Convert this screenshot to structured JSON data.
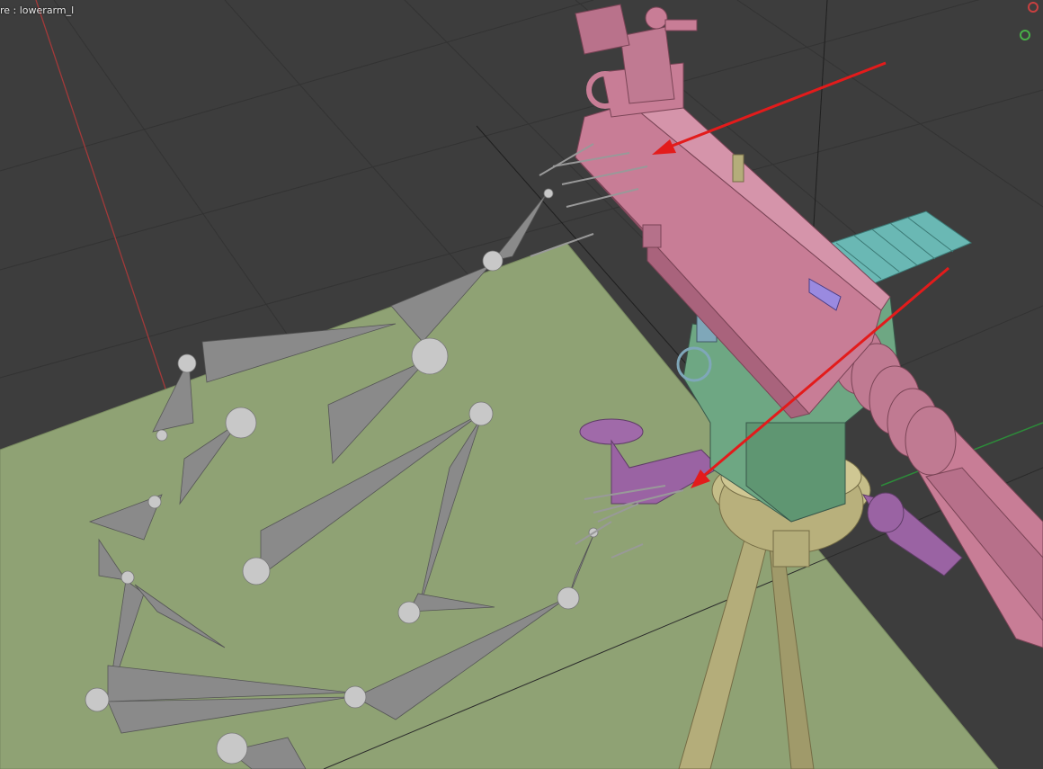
{
  "viewport": {
    "object_info": "re : lowerarm_l",
    "background_color": "#3d3d3d",
    "grid_color": "#333333",
    "ground_plane_color": "#8fa274",
    "x_axis_color": "#a33a3a",
    "bone_color": "#8a8a8a",
    "bone_joint_color": "#c8c8c8"
  },
  "scene": {
    "gun_body_color": "#c87d96",
    "mount_green_color": "#6ea783",
    "ammo_belt_color": "#6ab8b4",
    "tripod_color": "#b4ad7a",
    "purple_part_color": "#9a63a3",
    "annotation_arrow_color": "#e31b1b"
  },
  "gizmo": {
    "buttons": [
      "x-axis-handle",
      "y-axis-handle"
    ],
    "colors": [
      "#c84040",
      "#48b048"
    ]
  }
}
